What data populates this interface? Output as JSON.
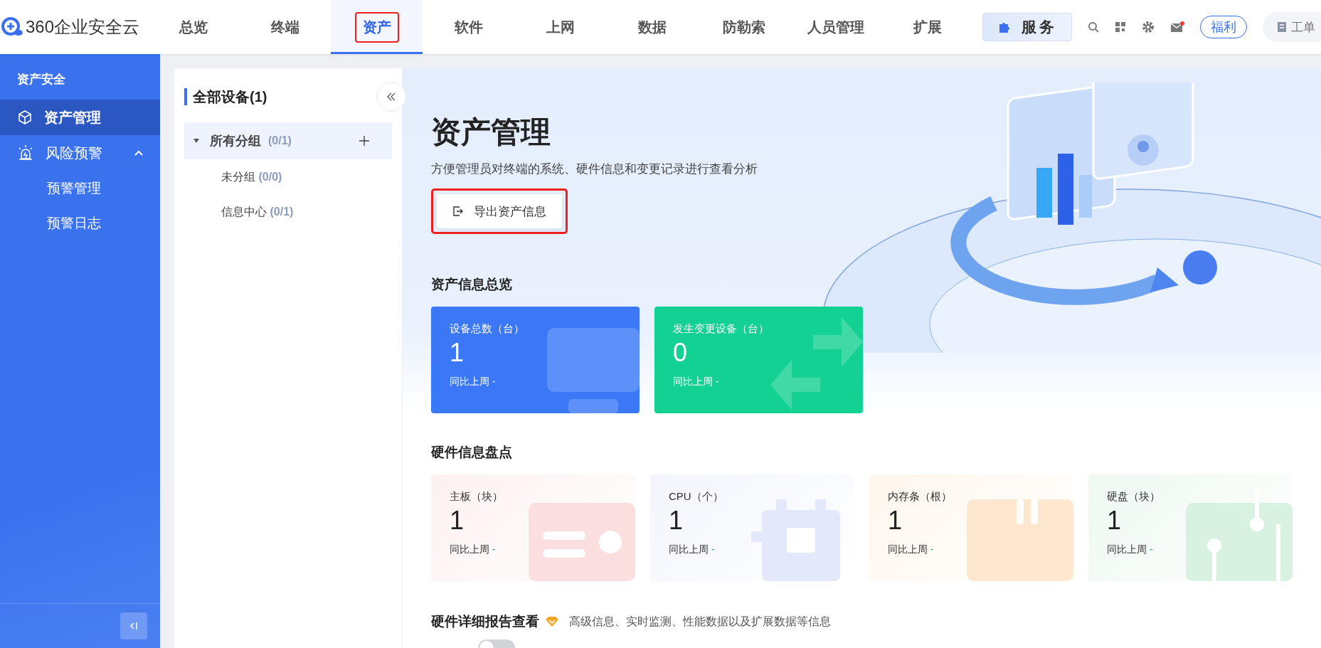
{
  "brand": {
    "name": "360企业安全云"
  },
  "nav_tabs": [
    {
      "label": "总览",
      "selected": false,
      "annotated": false
    },
    {
      "label": "终端",
      "selected": false,
      "annotated": false
    },
    {
      "label": "资产",
      "selected": true,
      "annotated": true
    },
    {
      "label": "软件",
      "selected": false,
      "annotated": false
    },
    {
      "label": "上网",
      "selected": false,
      "annotated": false
    },
    {
      "label": "数据",
      "selected": false,
      "annotated": false
    },
    {
      "label": "防勒索",
      "selected": false,
      "annotated": false
    },
    {
      "label": "人员管理",
      "selected": false,
      "annotated": false
    },
    {
      "label": "扩展",
      "selected": false,
      "annotated": false
    }
  ],
  "toolbar": {
    "service": "服务",
    "mail_unread": true,
    "welfare": "福利",
    "ticket": "工单"
  },
  "sidebar": {
    "title": "资产安全",
    "items": [
      {
        "label": "资产管理",
        "kind": "cube",
        "selected": true
      },
      {
        "label": "风险预警",
        "kind": "alarm",
        "selected": false,
        "expanded": true,
        "children": [
          {
            "label": "预警管理",
            "selected": false
          },
          {
            "label": "预警日志",
            "selected": false
          }
        ]
      }
    ]
  },
  "group_panel": {
    "title": "全部设备(1)",
    "tree": [
      {
        "label": "所有分组",
        "count": "(0/1)",
        "expanded": true,
        "selected": true,
        "children": [
          {
            "label": "未分组",
            "count": "(0/0)",
            "selected": false
          },
          {
            "label": "信息中心",
            "count": "(0/1)",
            "selected": false
          }
        ]
      }
    ]
  },
  "hero": {
    "title": "资产管理",
    "description": "方便管理员对终端的系统、硬件信息和变更记录进行查看分析",
    "export_button": {
      "label": "导出资产信息",
      "annotated": true
    }
  },
  "overview": {
    "title": "资产信息总览",
    "cards": [
      {
        "label": "设备总数（台）",
        "value": "1",
        "compare": "同比上周",
        "change": "-",
        "color": "#3a78f8",
        "kind": "monitor"
      },
      {
        "label": "发生变更设备（台）",
        "value": "0",
        "compare": "同比上周",
        "change": "-",
        "color": "#12d192",
        "kind": "exchange"
      }
    ]
  },
  "hardware": {
    "title": "硬件信息盘点",
    "cards": [
      {
        "label": "主板（块）",
        "value": "1",
        "compare": "同比上周",
        "change": "-",
        "kind": "board"
      },
      {
        "label": "CPU（个）",
        "value": "1",
        "compare": "同比上周",
        "change": "-",
        "kind": "cpu"
      },
      {
        "label": "内存条（根）",
        "value": "1",
        "compare": "同比上周",
        "change": "-",
        "kind": "memory"
      },
      {
        "label": "硬盘（块）",
        "value": "1",
        "compare": "同比上周",
        "change": "-",
        "kind": "disk"
      }
    ]
  },
  "report": {
    "title": "硬件详细报告查看",
    "description": "高级信息、实时监测、性能数据以及扩展数据等信息",
    "switch_on": false
  }
}
